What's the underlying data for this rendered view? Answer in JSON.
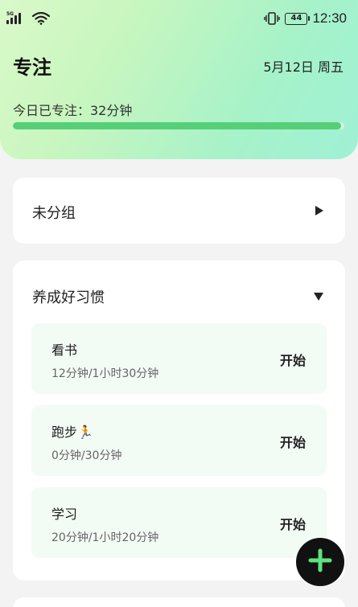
{
  "status_bar": {
    "network": "5G",
    "battery": "44",
    "time": "12:30",
    "icons": [
      "signal-icon",
      "wifi-icon",
      "vibrate-icon",
      "battery-icon"
    ]
  },
  "header": {
    "title": "专注",
    "date": "5月12日 周五",
    "focus_today": "今日已专注：32分钟",
    "progress_fraction": 0.99
  },
  "groups": [
    {
      "name": "未分组",
      "expanded": false
    },
    {
      "name": "养成好习惯",
      "expanded": true,
      "tasks": [
        {
          "name": "看书",
          "time": "12分钟/1小时30分钟",
          "action": "开始"
        },
        {
          "name": "跑步🏃",
          "time": "0分钟/30分钟",
          "action": "开始"
        },
        {
          "name": "学习",
          "time": "20分钟/1小时20分钟",
          "action": "开始"
        }
      ]
    }
  ],
  "fab": {
    "icon": "plus-icon"
  },
  "colors": {
    "accent": "#57cf79",
    "fab": "#111111",
    "fab_icon": "#5ee37f",
    "task_bg": "#f3fbf5"
  }
}
